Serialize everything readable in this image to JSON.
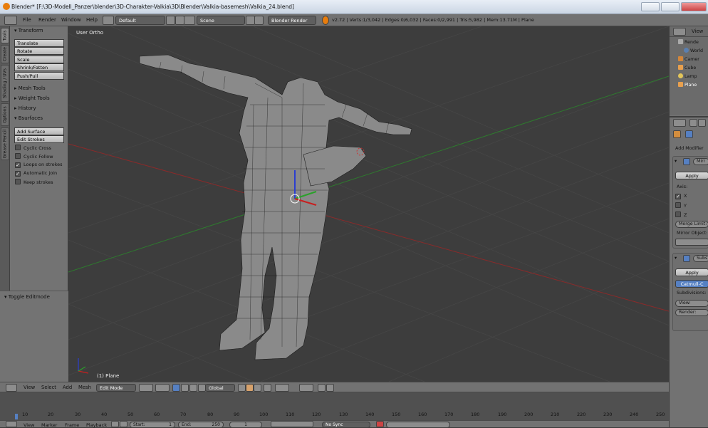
{
  "window": {
    "title": "Blender* [F:\\3D-Modell_Panzer\\blender\\3D-Charakter-Valkia\\3D\\Blender\\Valkia-basemesh\\Valkia_24.blend]"
  },
  "topbar": {
    "menus": [
      "File",
      "Render",
      "Window",
      "Help"
    ],
    "layout": "Default",
    "scene": "Scene",
    "engine": "Blender Render",
    "stats": "v2.72 | Verts:1/3,042 | Edges:0/6,032 | Faces:0/2,991 | Tris:5,982 | Mem:13.71M | Plane"
  },
  "tabs": [
    "Tools",
    "Create",
    "Shading / UVs",
    "Options",
    "Grease Pencil"
  ],
  "toolshelf": {
    "transform_header": "Transform",
    "transform_buttons": [
      "Translate",
      "Rotate",
      "Scale",
      "Shrink/Fatten",
      "Push/Pull"
    ],
    "panels": [
      "Mesh Tools",
      "Weight Tools",
      "History"
    ],
    "bsurfaces_header": "Bsurfaces",
    "bsurfaces_buttons": [
      "Add Surface",
      "Edit Strokes"
    ],
    "checkboxes": [
      {
        "label": "Cyclic Cross",
        "checked": false
      },
      {
        "label": "Cyclic Follow",
        "checked": false
      },
      {
        "label": "Loops on strokes",
        "checked": true
      },
      {
        "label": "Automatic join",
        "checked": true
      },
      {
        "label": "Keep strokes",
        "checked": false
      }
    ],
    "operator_panel": "Toggle Editmode"
  },
  "viewport": {
    "view_label": "User Ortho",
    "object_label": "(1) Plane"
  },
  "viewport_header": {
    "menus": [
      "View",
      "Select",
      "Add",
      "Mesh"
    ],
    "mode": "Edit Mode",
    "orientation": "Global"
  },
  "timeline": {
    "ticks": [
      "10",
      "20",
      "30",
      "40",
      "50",
      "60",
      "70",
      "80",
      "90",
      "100",
      "110",
      "120",
      "130",
      "140",
      "150",
      "160",
      "170",
      "180",
      "190",
      "200",
      "210",
      "220",
      "230",
      "240",
      "250"
    ]
  },
  "playback": {
    "menus": [
      "View",
      "Marker",
      "Frame",
      "Playback"
    ],
    "start": "Start:",
    "start_val": "1",
    "end": "End:",
    "end_val": "250",
    "current": "1",
    "sync": "No Sync"
  },
  "outliner": {
    "header": "View",
    "items": [
      "Rende",
      "World",
      "Camer",
      "Cube",
      "Lamp",
      "Plane"
    ]
  },
  "properties": {
    "add_modifier": "Add Modifier",
    "mod1_name": "Mirr",
    "apply": "Apply",
    "axis": "Axis:",
    "axes": [
      "X",
      "Y",
      "Z"
    ],
    "merge_limit": "Merge Limit:",
    "mirror_object": "Mirror Object:",
    "mod2_name": "Subs",
    "apply2": "Apply",
    "catmull": "Catmull-C",
    "subdivisions": "Subdivisions:",
    "view": "View:",
    "render": "Render:"
  },
  "colors": {
    "accent": "#e87d0d",
    "selected": "#5680c2",
    "x_axis": "#b03030",
    "y_axis": "#3a9a3a"
  }
}
